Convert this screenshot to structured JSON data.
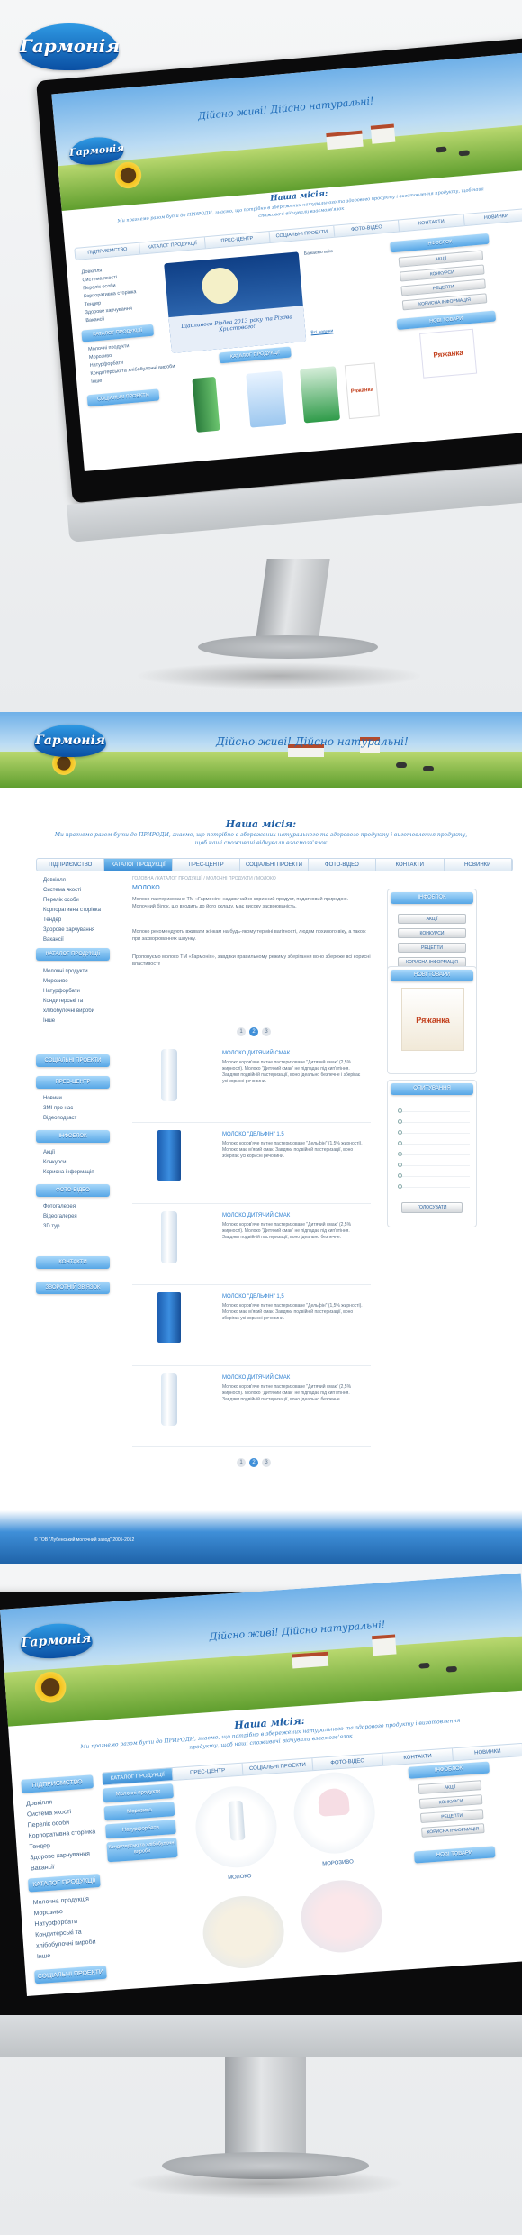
{
  "brand": {
    "logo_text": "Гармонія",
    "tagline": "Дійсно живі! Дійсно натуральні!"
  },
  "mission": {
    "title": "Наша місія:",
    "text": "Ми прагнемо разом бути до ПРИРОДИ, знаємо, що потрібно в збережених натурального та здорового продукту і виготовлення продукту, щоб наші споживачі відчували взаємозв'язок"
  },
  "nav": [
    "ПІДПРИЄМСТВО",
    "КАТАЛОГ ПРОДУКЦІЇ",
    "ПРЕС-ЦЕНТР",
    "СОЦІАЛЬНІ ПРОЕКТИ",
    "ФОТО-ВІДЕО",
    "КОНТАКТИ",
    "НОВИНКИ"
  ],
  "screen1": {
    "left_top": [
      "Довкілля",
      "Система якості",
      "Перелік особи",
      "Корпоративна сторінка",
      "Тендер",
      "Здорове харчування",
      "Вакансії"
    ],
    "catalog_btn": "КАТАЛОГ ПРОДУКЦІЇ",
    "catalog_items": [
      "Молочні продукти",
      "Морозиво",
      "Натурфорбати",
      "Кондитерські та хлібобулочні вироби",
      "Інше"
    ],
    "social_btn": "СОЦІАЛЬНІ ПРОЕКТИ",
    "banner_text": "Щасливого Різдва 2013 року та Різдва Христового!",
    "news_title": "Бажаємо всім",
    "news_link": "Всі новини",
    "catalog_strip": "КАТАЛОГ ПРОДУКЦІЇ",
    "infoblock": "ІНФОБЛОК",
    "info_btns": [
      "АКЦІЇ",
      "КОНКУРСИ",
      "РЕЦЕПТИ",
      "КОРИСНА ІНФОРМАЦІЯ"
    ],
    "new_goods": "НОВІ ТОВАРИ",
    "pack1": "Ряжанка",
    "pack2": "Ряжанка"
  },
  "screen2": {
    "left_top": [
      "Довкілля",
      "Система якості",
      "Перелік особи",
      "Корпоративна сторінка",
      "Тендер",
      "Здорове харчування",
      "Вакансії"
    ],
    "catalog_btn": "КАТАЛОГ ПРОДУКЦІЇ",
    "catalog_items": [
      "Молочні продукти",
      "Морозиво",
      "Натурфорбати",
      "Кондитерські та хлібобулочні вироби",
      "Інше"
    ],
    "social_btn": "СОЦІАЛЬНІ ПРОЕКТИ",
    "press_btn": "ПРЕС-ЦЕНТР",
    "press_items": [
      "Новини",
      "ЗМІ про нас",
      "Відеоподкаст"
    ],
    "info_btn": "ІНФОБЛОК",
    "info_items": [
      "Акції",
      "Конкурси",
      "Корисна інформація"
    ],
    "photo_btn": "ФОТО-ВІДЕО",
    "photo_items": [
      "Фотогалерея",
      "Відеогалерея",
      "3D тур"
    ],
    "contacts_btn": "КОНТАКТИ",
    "feedback_btn": "ЗВОРОТНІЙ ЗВ'ЯЗОК",
    "breadcrumb": "ГОЛОВНА / КАТАЛОГ ПРОДУКЦІЇ / МОЛОЧНІ ПРОДУКТИ / МОЛОКО",
    "heading": "МОЛОКО",
    "intro1": "Молоко пастеризоване ТМ «Гармонія» надзвичайно корисний продукт, податковий природою. Молочний білок, що входить до його складу, має високу засвоюваність.",
    "intro2": "Молоко рекомендують вживати жінкам на будь-якому терміні вагітності, людям похилого віку, а також при захворюваннях шлунку.",
    "intro3": "Пропонуємо молоко ТМ «Гармонія», завдяки правильному режиму зберігання воно збереже всі корисні властивості!",
    "products": [
      {
        "name": "МОЛОКО ДИТЯЧИЙ СМАК",
        "desc": "Молоко коров'яче питне пастеризоване \"Дитячий смак\" (2,5% жирності). Молоко \"Дитячий смак\" не підпадає під кип'ятіння. Завдяки подвійній пастеризації, воно ідеально безпечне і зберігає усі корисні речовини."
      },
      {
        "name": "МОЛОКО \"ДЕЛЬФІН\" 1,5",
        "desc": "Молоко коров'яче питне пастеризоване \"Дельфін\" (1,5% жирності). Молоко має м'який смак. Завдяки подвійній пастеризації, воно зберігає усі корисні речовини."
      },
      {
        "name": "МОЛОКО ДИТЯЧИЙ СМАК",
        "desc": "Молоко коров'яче питне пастеризоване \"Дитячий смак\" (2,5% жирності). Молоко \"Дитячий смак\" не підпадає під кип'ятіння. Завдяки подвійній пастеризації, воно ідеально безпечне."
      },
      {
        "name": "МОЛОКО \"ДЕЛЬФІН\" 1,5",
        "desc": "Молоко коров'яче питне пастеризоване \"Дельфін\" (1,5% жирності). Молоко має м'який смак. Завдяки подвійній пастеризації, воно зберігає усі корисні речовини."
      },
      {
        "name": "МОЛОКО ДИТЯЧИЙ СМАК",
        "desc": "Молоко коров'яче питне пастеризоване \"Дитячий смак\" (2,5% жирності). Молоко \"Дитячий смак\" не підпадає під кип'ятіння. Завдяки подвійній пастеризації, воно ідеально безпечне."
      }
    ],
    "pager": [
      "1",
      "2",
      "3"
    ],
    "right_info": "ІНФОБЛОК",
    "right_btns": [
      "АКЦІЇ",
      "КОНКУРСИ",
      "РЕЦЕПТИ",
      "КОРИСНА ІНФОРМАЦІЯ"
    ],
    "new_goods": "НОВІ ТОВАРИ",
    "pack": "Ряжанка",
    "poll": "ОПИТУВАННЯ",
    "poll_btn": "ГОЛОСУВАТИ",
    "footer": "© ТОВ \"Лубенський молочний завод\" 2005-2012"
  },
  "screen3": {
    "left_top": [
      "Довкілля",
      "Система якості",
      "Перелік особи",
      "Корпоративна сторінка",
      "Тендер",
      "Здорове харчування",
      "Вакансії"
    ],
    "catalog_btn": "КАТАЛОГ ПРОДУКЦІЇ",
    "catalog_items": [
      "Молочна продукція",
      "Морозиво",
      "Натурфорбати",
      "Кондитерські та хлібобулочні вироби",
      "Інше"
    ],
    "social_btn": "СОЦІАЛЬНІ ПРОЕКТИ",
    "dropdown": [
      "Молочні продукти",
      "Морозиво",
      "Натурфорбати",
      "Кондитерські та хлібобулочні вироби"
    ],
    "tile1": "МОЛОКО",
    "tile2": "МОРОЗИВО",
    "right_info": "ІНФОБЛОК",
    "right_btns": [
      "АКЦІЇ",
      "КОНКУРСИ",
      "РЕЦЕПТИ",
      "КОРИСНА ІНФОРМАЦІЯ"
    ],
    "new_goods": "НОВІ ТОВАРИ"
  },
  "colors": {
    "accent": "#3d8fd6",
    "nav_text": "#2b63a0",
    "brand_blue": "#0a4fa3",
    "grass": "#5f9e2e"
  }
}
